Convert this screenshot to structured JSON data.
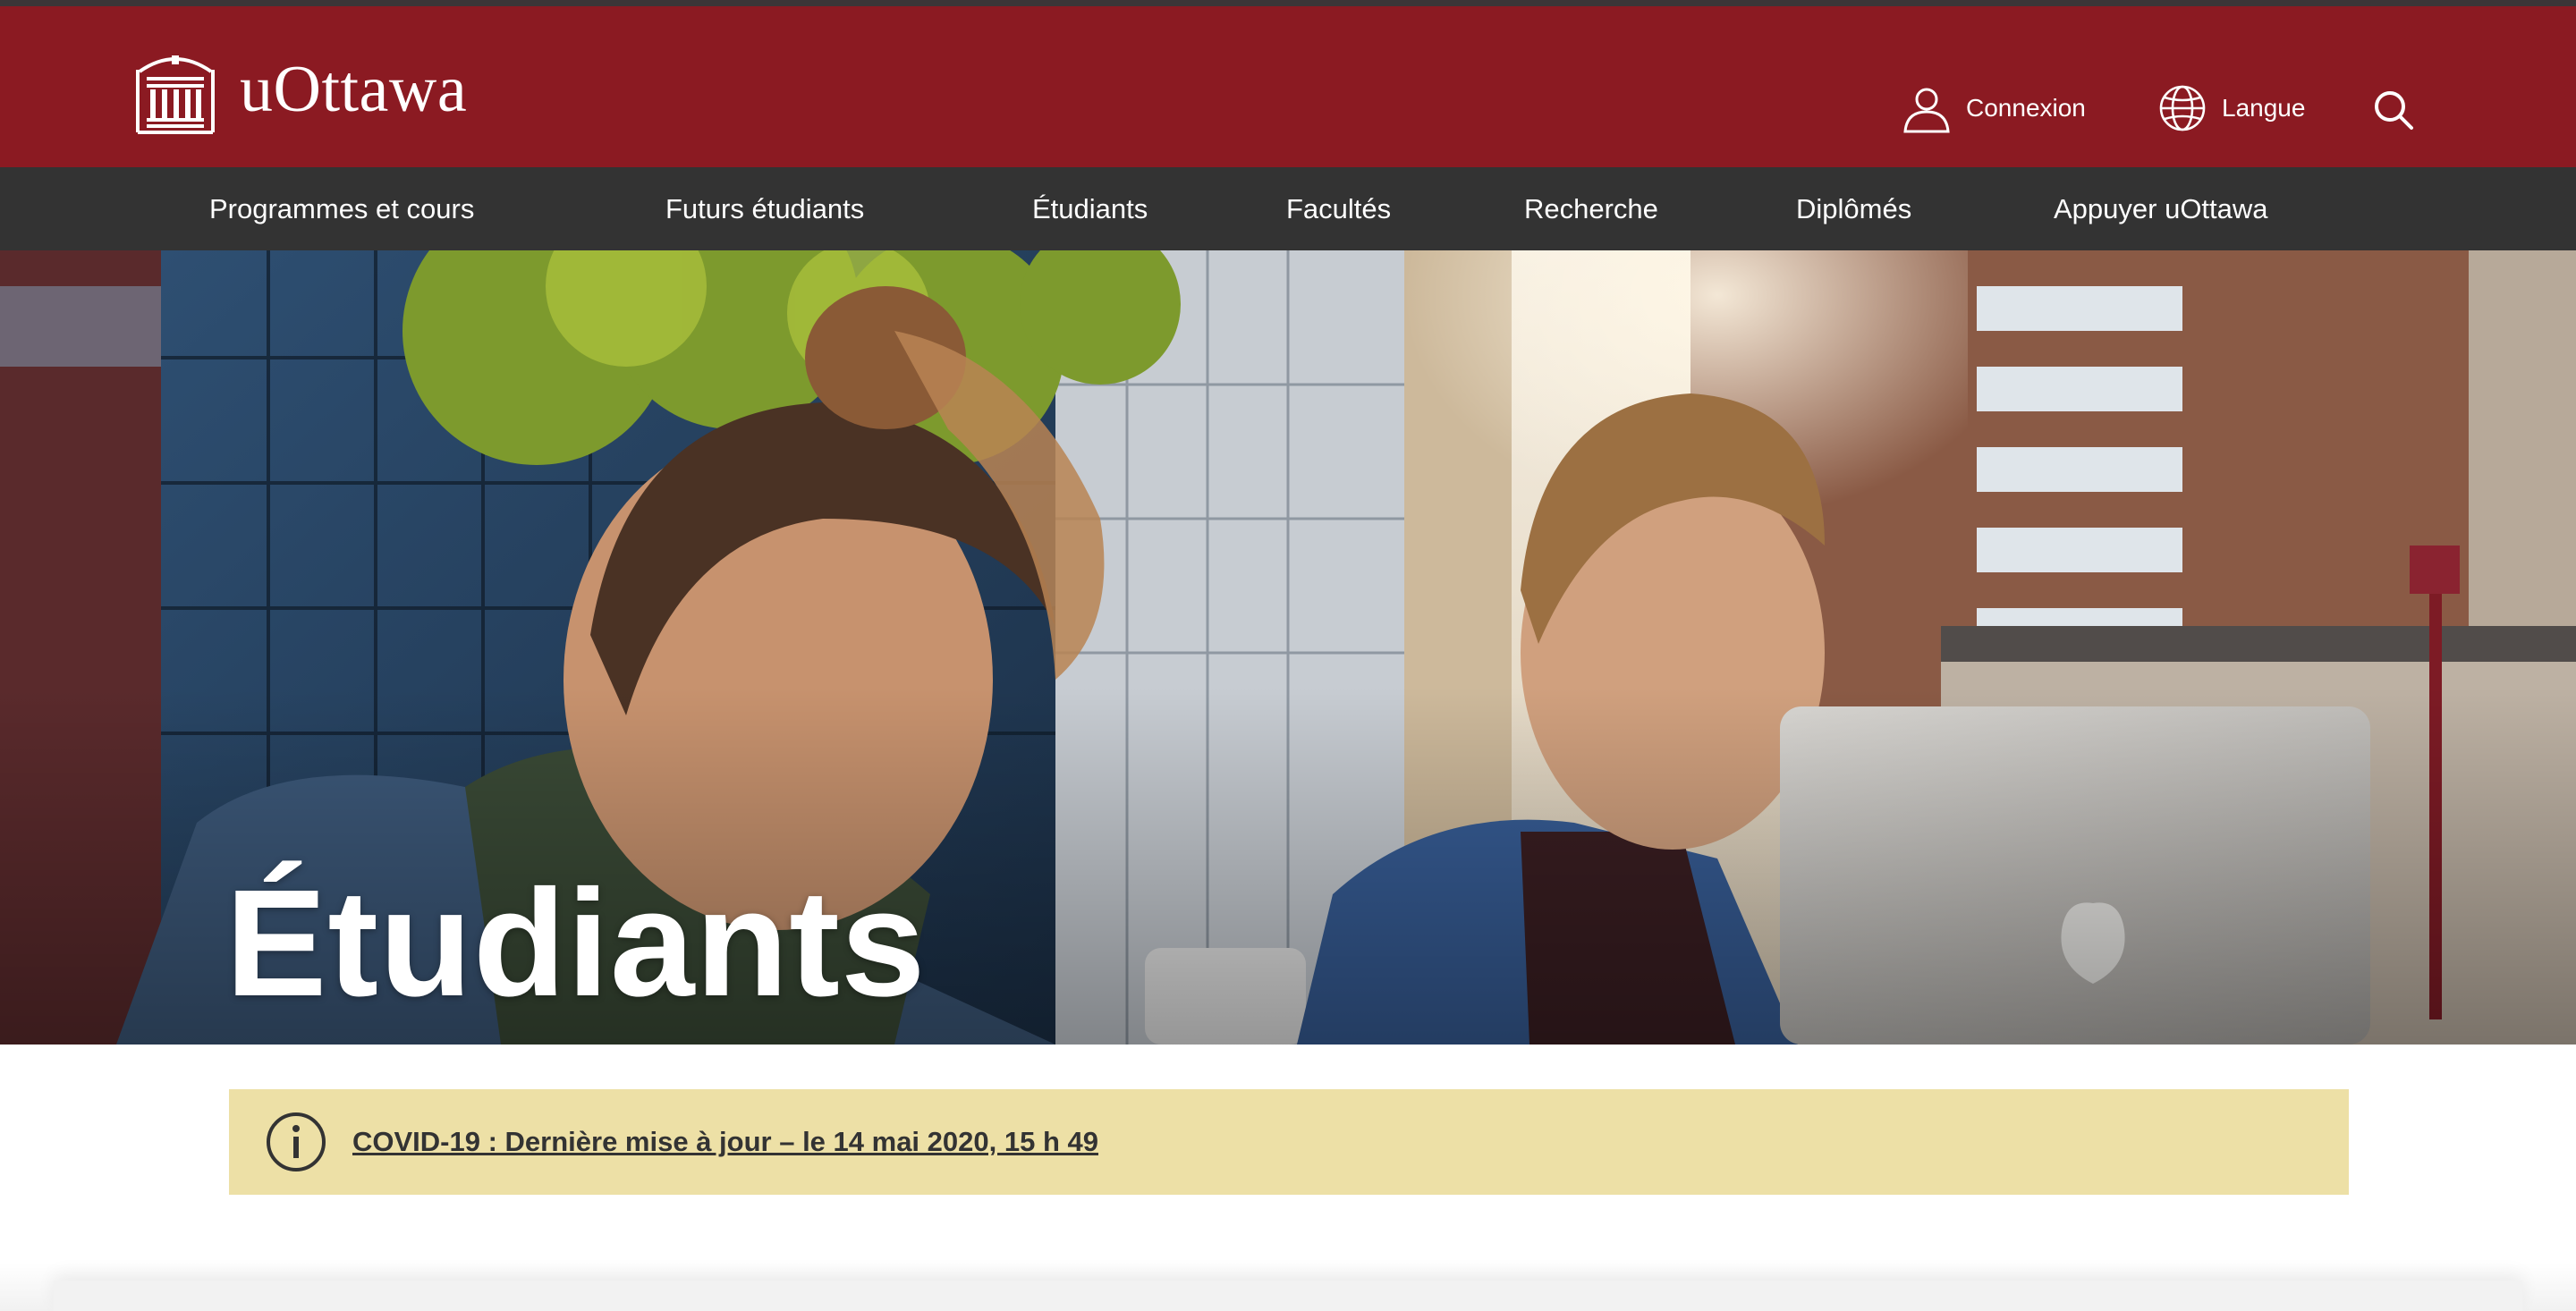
{
  "header": {
    "logo_text": "uOttawa",
    "login_label": "Connexion",
    "language_label": "Langue",
    "brand_color": "#8b1a22",
    "icons": [
      "building-logo-icon",
      "user-icon",
      "globe-icon",
      "search-icon"
    ]
  },
  "nav": {
    "background": "#333333",
    "items": [
      {
        "label": "Programmes et cours"
      },
      {
        "label": "Futurs étudiants"
      },
      {
        "label": "Étudiants"
      },
      {
        "label": "Facultés"
      },
      {
        "label": "Recherche"
      },
      {
        "label": "Diplômés"
      },
      {
        "label": "Appuyer uOttawa"
      }
    ]
  },
  "hero": {
    "title": "Étudiants"
  },
  "alert": {
    "text": "COVID-19 : Dernière mise à jour – le 14 mai 2020, 15 h 49",
    "background": "#ede0a6",
    "icon": "info-icon"
  }
}
